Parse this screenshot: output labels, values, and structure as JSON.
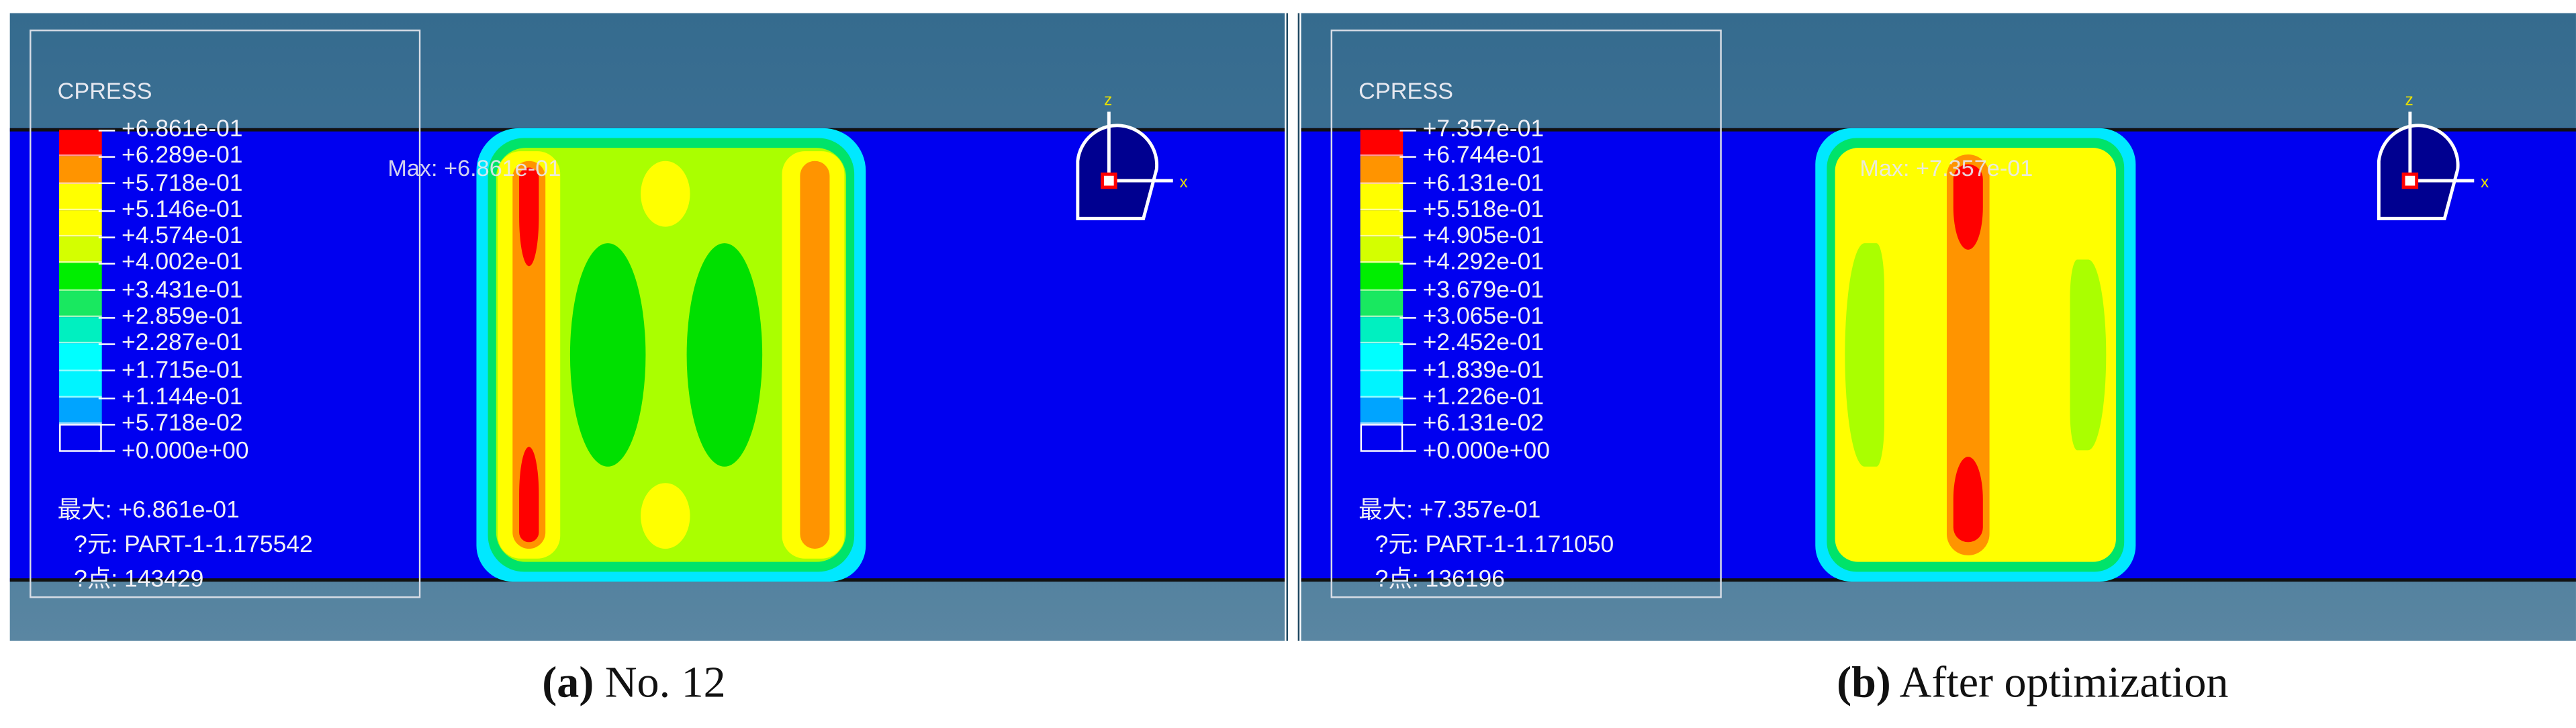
{
  "colors": [
    "#ff0000",
    "#ff9400",
    "#ffff00",
    "#ffff00",
    "#d4ff00",
    "#00ee00",
    "#19e860",
    "#00f0c0",
    "#00ffff",
    "#00f4ff",
    "#00a4ff",
    "#0000f0"
  ],
  "panels": [
    {
      "legend_title": "CPRESS",
      "legend_values": [
        "+6.861e-01",
        "+6.289e-01",
        "+5.718e-01",
        "+5.146e-01",
        "+4.574e-01",
        "+4.002e-01",
        "+3.431e-01",
        "+2.859e-01",
        "+2.287e-01",
        "+1.715e-01",
        "+1.144e-01",
        "+5.718e-02",
        "+0.000e+00"
      ],
      "max_line": "最大: +6.861e-01",
      "element_line": "?元: PART-1-1.175542",
      "node_line": "?点: 143429",
      "max_label": "Max: +6.861e-01",
      "axis_z": "z",
      "axis_x": "x",
      "caption_letter": "(a)",
      "caption_text": " No. 12"
    },
    {
      "legend_title": "CPRESS",
      "legend_values": [
        "+7.357e-01",
        "+6.744e-01",
        "+6.131e-01",
        "+5.518e-01",
        "+4.905e-01",
        "+4.292e-01",
        "+3.679e-01",
        "+3.065e-01",
        "+2.452e-01",
        "+1.839e-01",
        "+1.226e-01",
        "+6.131e-02",
        "+0.000e+00"
      ],
      "max_line": "最大: +7.357e-01",
      "element_line": "?元: PART-1-1.171050",
      "node_line": "?点: 136196",
      "max_label": "Max: +7.357e-01",
      "axis_z": "z",
      "axis_x": "x",
      "caption_letter": "(b)",
      "caption_text": " After optimization"
    }
  ]
}
